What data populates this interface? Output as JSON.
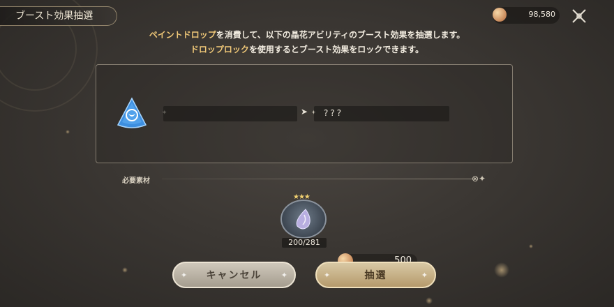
{
  "header": {
    "title": "ブースト効果抽選"
  },
  "currency": {
    "amount": "98,580",
    "icon": "coin-icon"
  },
  "close": {
    "icon": "close-icon"
  },
  "description": {
    "line1_hl": "ペイントドロップ",
    "line1_rest": "を消費して、以下の晶花アビリティのブースト効果を抽選します。",
    "line2_hl": "ドロップロック",
    "line2_rest": "を使用するとブースト効果をロックできます。"
  },
  "ability": {
    "icon": "crystal-flower-ability-icon",
    "current_effect": "",
    "next_effect": "???"
  },
  "materials": {
    "label": "必要素材",
    "item": {
      "icon": "paint-drop-icon",
      "rarity_stars": 3,
      "owned": "200/281"
    }
  },
  "cost": {
    "amount": "500",
    "icon": "coin-icon"
  },
  "buttons": {
    "cancel": "キャンセル",
    "draw": "抽選"
  }
}
